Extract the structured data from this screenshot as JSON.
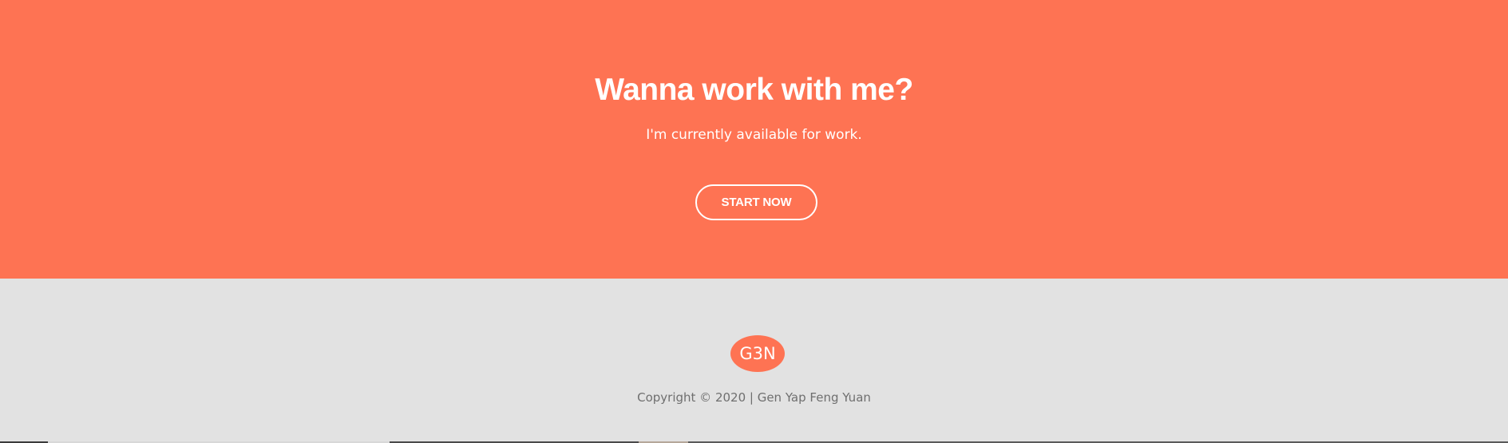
{
  "cta": {
    "title": "Wanna work with me?",
    "subtitle": "I'm currently available for work.",
    "button_label": "START NOW"
  },
  "footer": {
    "logo_text": "G3N",
    "copyright": "Copyright © 2020 | Gen Yap Feng Yuan"
  },
  "colors": {
    "accent": "#fe7353",
    "footer_bg": "#e2e2e2",
    "text_light": "#ffffff",
    "text_muted": "#6f6f6f"
  }
}
